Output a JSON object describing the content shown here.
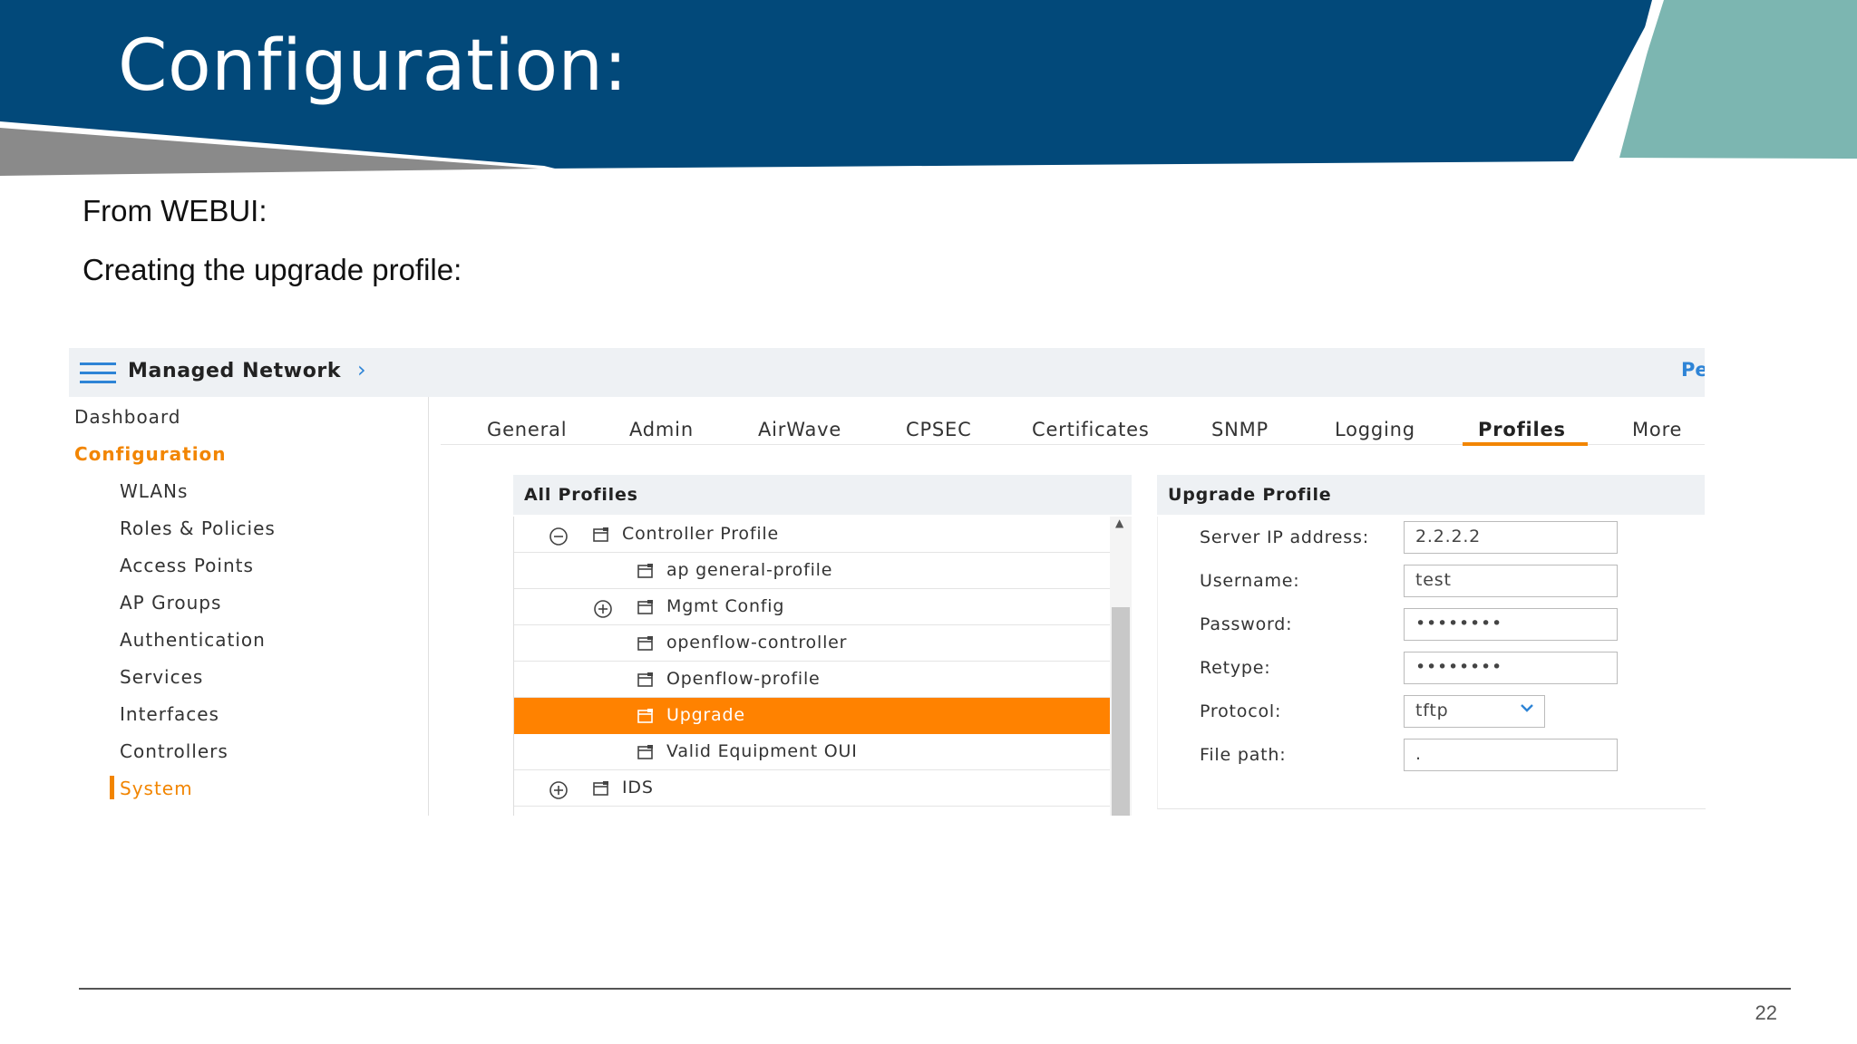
{
  "slide": {
    "title": "Configuration:",
    "intro_line1": "From WEBUI:",
    "intro_line2": "Creating the upgrade profile:",
    "page_number": "22"
  },
  "app": {
    "header_title": "Managed Network",
    "header_link_partial": "Pe",
    "accent_color": "#f28500",
    "link_color": "#2e84d6"
  },
  "sidebar": {
    "items": [
      {
        "label": "Dashboard",
        "active": false
      },
      {
        "label": "Configuration",
        "active": true
      },
      {
        "label": "WLANs",
        "active": false
      },
      {
        "label": "Roles & Policies",
        "active": false
      },
      {
        "label": "Access Points",
        "active": false
      },
      {
        "label": "AP Groups",
        "active": false
      },
      {
        "label": "Authentication",
        "active": false
      },
      {
        "label": "Services",
        "active": false
      },
      {
        "label": "Interfaces",
        "active": false
      },
      {
        "label": "Controllers",
        "active": false
      },
      {
        "label": "System",
        "active": true
      }
    ]
  },
  "tabs": [
    {
      "label": "General"
    },
    {
      "label": "Admin"
    },
    {
      "label": "AirWave"
    },
    {
      "label": "CPSEC"
    },
    {
      "label": "Certificates"
    },
    {
      "label": "SNMP"
    },
    {
      "label": "Logging"
    },
    {
      "label": "Profiles",
      "active": true
    },
    {
      "label": "More"
    }
  ],
  "all_profiles": {
    "title": "All Profiles",
    "rows": [
      {
        "label": "Controller Profile",
        "toggle": "collapse"
      },
      {
        "label": "ap general-profile"
      },
      {
        "label": "Mgmt Config",
        "toggle": "expand"
      },
      {
        "label": "openflow-controller"
      },
      {
        "label": "Openflow-profile"
      },
      {
        "label": "Upgrade",
        "selected": true
      },
      {
        "label": "Valid Equipment OUI"
      },
      {
        "label": "IDS",
        "toggle": "expand"
      }
    ]
  },
  "upgrade_profile": {
    "title": "Upgrade Profile",
    "fields": {
      "server_ip": {
        "label": "Server IP address:",
        "value": "2.2.2.2"
      },
      "username": {
        "label": "Username:",
        "value": "test"
      },
      "password": {
        "label": "Password:",
        "value": "••••••••"
      },
      "retype": {
        "label": "Retype:",
        "value": "••••••••"
      },
      "protocol": {
        "label": "Protocol:",
        "value": "tftp"
      },
      "file_path": {
        "label": "File path:",
        "value": "."
      }
    }
  }
}
